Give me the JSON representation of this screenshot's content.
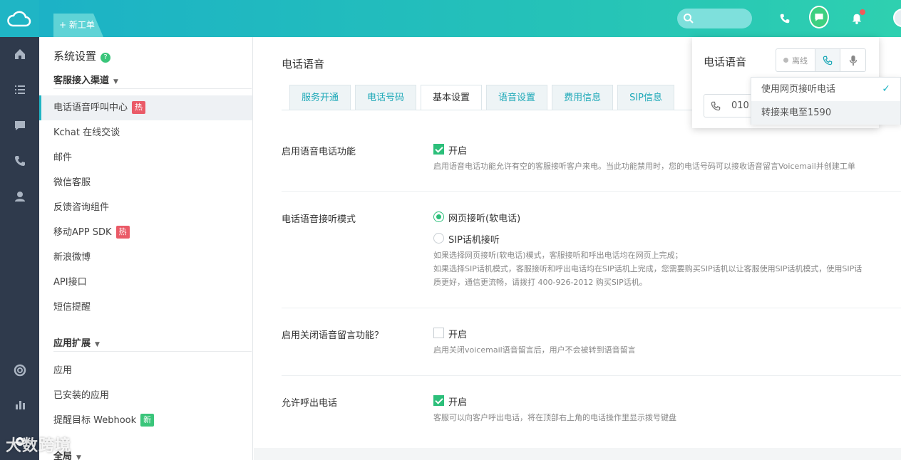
{
  "topbar": {
    "new_ticket": "+ 新工单"
  },
  "sidebar": {
    "title": "系统设置",
    "help": "?",
    "group1": "客服接入渠道",
    "items1": [
      {
        "label": "电话语音呼叫中心",
        "badge": "热"
      },
      {
        "label": "Kchat 在线交谈"
      },
      {
        "label": "邮件"
      },
      {
        "label": "微信客服"
      },
      {
        "label": "反馈咨询组件"
      },
      {
        "label": "移动APP SDK",
        "badge": "热"
      },
      {
        "label": "新浪微博"
      },
      {
        "label": "API接口"
      },
      {
        "label": "短信提醒"
      }
    ],
    "group2": "应用扩展",
    "items2": [
      {
        "label": "应用"
      },
      {
        "label": "已安装的应用"
      },
      {
        "label": "提醒目标 Webhook",
        "badge": "新"
      }
    ],
    "group3": "全局"
  },
  "main": {
    "title": "电话语音",
    "tabs": [
      "服务开通",
      "电话号码",
      "基本设置",
      "语音设置",
      "费用信息",
      "SIP信息"
    ],
    "active_tab": "基本设置",
    "rows": {
      "voice": {
        "label": "启用语音电话功能",
        "option": "开启",
        "hint": "启用语音电话功能允许有空的客服接听客户来电。当此功能禁用时，您的电话号码可以接收语音留言Voicemail并创建工单"
      },
      "mode": {
        "label": "电话语音接听模式",
        "opt1": "网页接听(软电话)",
        "opt2": "SIP话机接听",
        "hint1": "如果选择网页接听(软电话)模式，客服接听和呼出电话均在网页上完成；",
        "hint2": "如果选择SIP话机模式，客服接听和呼出电话均在SIP话机上完成，您需要购买SIP话机以让客服使用SIP话机模式，使用SIP话",
        "hint3": "质更好，通信更流畅，请拨打 400-926-2012 购买SIP话机。"
      },
      "voicemail": {
        "label": "启用关闭语音留言功能？",
        "option": "开启",
        "hint": "启用关闭voicemail语音留言后，用户不会被转到语音留言"
      },
      "outbound": {
        "label": "允许呼出电话",
        "option": "开启",
        "hint": "客服可以向客户呼出电话，将在顶部右上角的电话操作里显示拨号键盘"
      }
    }
  },
  "popover": {
    "title": "电话语音",
    "offline": "离线",
    "number_prefix": "010",
    "options": [
      "使用网页接听电话",
      "转接来电至1590"
    ],
    "selected_check": "✓"
  },
  "watermark": "大数跨境",
  "colors": {
    "accent": "#20b5c4",
    "green": "#2cbf7a",
    "hot": "#ea5a67",
    "rail": "#2f3a4c"
  }
}
